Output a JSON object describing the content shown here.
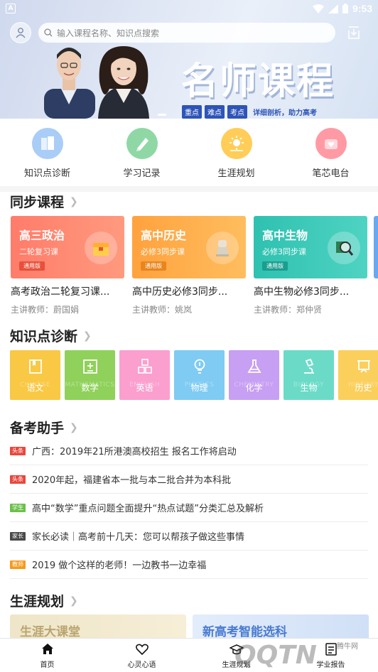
{
  "status_bar": {
    "time": "9:53",
    "app_icon_letter": "A"
  },
  "search": {
    "placeholder": "输入课程名称、知识点搜索"
  },
  "banner": {
    "title": "名师课程",
    "tags": [
      "重点",
      "难点",
      "考点"
    ],
    "subtitle": "详细剖析，助力高考"
  },
  "quick_menu": [
    {
      "label": "知识点诊断",
      "color": "#9cc4f4",
      "icon": "book-stack-icon"
    },
    {
      "label": "学习记录",
      "color": "#8fd8a6",
      "icon": "pencil-icon"
    },
    {
      "label": "生涯规划",
      "color": "#ffcf5e",
      "icon": "sun-icon"
    },
    {
      "label": "笔芯电台",
      "color": "#ff9aa4",
      "icon": "heart-radio-icon"
    }
  ],
  "sync_courses": {
    "title": "同步课程",
    "courses": [
      {
        "cover_title": "高三政治",
        "cover_sub": "二轮复习课",
        "badge": "通用版",
        "name": "高考政治二轮复习课...",
        "teacher": "主讲教师：蔚国娟",
        "color_start": "#ff7c6a",
        "color_end": "#ff9a7e",
        "badge_color": "#e8503a",
        "icon": "treasure-box-icon"
      },
      {
        "cover_title": "高中历史",
        "cover_sub": "必修3同步课",
        "badge": "通用版",
        "name": "高中历史必修3同步...",
        "teacher": "主讲教师：姚岚",
        "color_start": "#ffa23e",
        "color_end": "#ffbd5e",
        "badge_color": "#e9851c",
        "icon": "statue-icon"
      },
      {
        "cover_title": "高中生物",
        "cover_sub": "必修3同步课",
        "badge": "通用版",
        "name": "高中生物必修3同步...",
        "teacher": "主讲教师：郑仲贤",
        "color_start": "#2fc1b0",
        "color_end": "#4fd3c2",
        "badge_color": "#1a9e8f",
        "icon": "magnifier-icon"
      }
    ]
  },
  "knowledge": {
    "title": "知识点诊断",
    "subjects": [
      {
        "label": "语文",
        "bg": "CHINESE",
        "color": "#f9c844",
        "icon": "book-icon"
      },
      {
        "label": "数学",
        "bg": "MATHEMATICS",
        "color": "#8fd15a",
        "icon": "math-icon"
      },
      {
        "label": "英语",
        "bg": "ENGLISH",
        "color": "#fb9fcf",
        "icon": "abc-icon"
      },
      {
        "label": "物理",
        "bg": "PHYSICS",
        "color": "#7fcbf3",
        "icon": "bulb-icon"
      },
      {
        "label": "化学",
        "bg": "CHEMISTRY",
        "color": "#c79ff3",
        "icon": "flask-icon"
      },
      {
        "label": "生物",
        "bg": "BIOLOGY",
        "color": "#6bdbc8",
        "icon": "microscope-icon"
      },
      {
        "label": "历史",
        "bg": "HISTORY",
        "color": "#fbcf5c",
        "icon": "board-icon"
      }
    ]
  },
  "exam_helper": {
    "title": "备考助手",
    "news": [
      {
        "tag": "头条",
        "tag_color": "#e9473d",
        "text": "广西：2019年21所港澳高校招生 报名工作将启动"
      },
      {
        "tag": "头条",
        "tag_color": "#e9473d",
        "text": "2020年起，福建省本一批与本二批合并为本科批"
      },
      {
        "tag": "学生",
        "tag_color": "#6cc04a",
        "text": "高中“数学”重点问题全面提升“热点试题”分类汇总及解析"
      },
      {
        "tag": "家长",
        "tag_color": "#4a4a4a",
        "text": "家长必读｜高考前十几天：您可以帮孩子做这些事情"
      },
      {
        "tag": "教师",
        "tag_color": "#f59a1c",
        "text": "2019 做个这样的老师！一边教书一边幸福"
      }
    ]
  },
  "career": {
    "title": "生涯规划",
    "cards": [
      "生涯大课堂",
      "新高考智能选科"
    ]
  },
  "tab_bar": {
    "tabs": [
      {
        "label": "首页",
        "icon": "home-icon"
      },
      {
        "label": "心灵心语",
        "icon": "heart-icon"
      },
      {
        "label": "生涯规划",
        "icon": "mortarboard-icon"
      },
      {
        "label": "学业报告",
        "icon": "report-icon"
      }
    ]
  },
  "watermark": {
    "text": "QQTN",
    "small": "腾牛网"
  }
}
